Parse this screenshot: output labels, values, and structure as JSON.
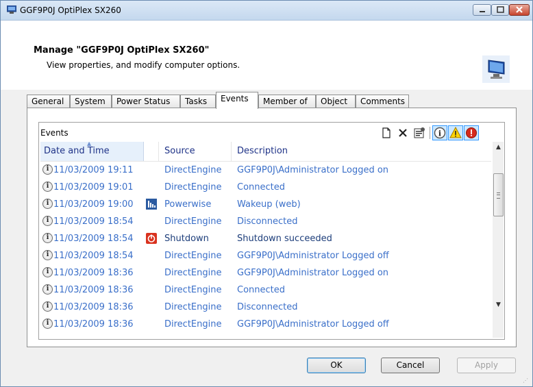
{
  "window": {
    "title": "GGF9P0J OptiPlex SX260"
  },
  "header": {
    "title": "Manage \"GGF9P0J OptiPlex SX260\"",
    "subtitle": "View properties, and modify computer options."
  },
  "tabs": [
    {
      "label": "General"
    },
    {
      "label": "System"
    },
    {
      "label": "Power Status"
    },
    {
      "label": "Tasks"
    },
    {
      "label": "Events",
      "selected": true
    },
    {
      "label": "Member of"
    },
    {
      "label": "Object"
    },
    {
      "label": "Comments"
    }
  ],
  "events": {
    "group_label": "Events",
    "toolbar_icons": [
      "new-document-icon",
      "delete-icon",
      "properties-icon",
      "info-filter-icon",
      "warning-filter-icon",
      "error-filter-icon"
    ],
    "columns": {
      "datetime": "Date and Time",
      "source": "Source",
      "description": "Description"
    },
    "rows": [
      {
        "datetime": "11/03/2009 19:11",
        "source": "DirectEngine",
        "description": "GGF9P0J\\Administrator Logged on",
        "source_icon": ""
      },
      {
        "datetime": "11/03/2009 19:01",
        "source": "DirectEngine",
        "description": "Connected",
        "source_icon": ""
      },
      {
        "datetime": "11/03/2009 19:00",
        "source": "Powerwise",
        "description": "Wakeup (web)",
        "source_icon": "powerwise-icon"
      },
      {
        "datetime": "11/03/2009 18:54",
        "source": "DirectEngine",
        "description": "Disconnected",
        "source_icon": ""
      },
      {
        "datetime": "11/03/2009 18:54",
        "source": "Shutdown",
        "description": "Shutdown succeeded",
        "source_icon": "shutdown-icon"
      },
      {
        "datetime": "11/03/2009 18:54",
        "source": "DirectEngine",
        "description": "GGF9P0J\\Administrator Logged off",
        "source_icon": ""
      },
      {
        "datetime": "11/03/2009 18:36",
        "source": "DirectEngine",
        "description": "GGF9P0J\\Administrator Logged on",
        "source_icon": ""
      },
      {
        "datetime": "11/03/2009 18:36",
        "source": "DirectEngine",
        "description": "Connected",
        "source_icon": ""
      },
      {
        "datetime": "11/03/2009 18:36",
        "source": "DirectEngine",
        "description": "Disconnected",
        "source_icon": ""
      },
      {
        "datetime": "11/03/2009 18:36",
        "source": "DirectEngine",
        "description": "GGF9P0J\\Administrator Logged off",
        "source_icon": ""
      }
    ]
  },
  "buttons": {
    "ok": "OK",
    "cancel": "Cancel",
    "apply": "Apply"
  },
  "colors": {
    "link_text": "#3a6fc9",
    "header_bg": "#ffffff",
    "tab_selected_bg": "#ffffff"
  }
}
